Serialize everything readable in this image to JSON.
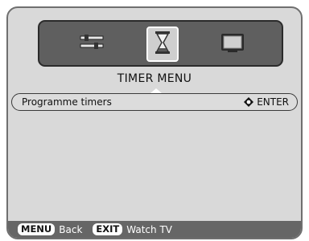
{
  "icons": {
    "tab1": "settings-sliders-icon",
    "tab2": "hourglass-icon",
    "tab3": "tv-icon"
  },
  "menu": {
    "title": "TIMER MENU",
    "rows": [
      {
        "label": "Programme timers",
        "hint": "ENTER",
        "hint_icon": "navigation-pad-icon"
      }
    ]
  },
  "footer": {
    "menu_key": "MENU",
    "menu_label": "Back",
    "exit_key": "EXIT",
    "exit_label": "Watch TV"
  },
  "colors": {
    "panel_bg": "#d9d9d9",
    "icon_bar_bg": "#5f5f5f",
    "footer_bg": "#666666"
  }
}
